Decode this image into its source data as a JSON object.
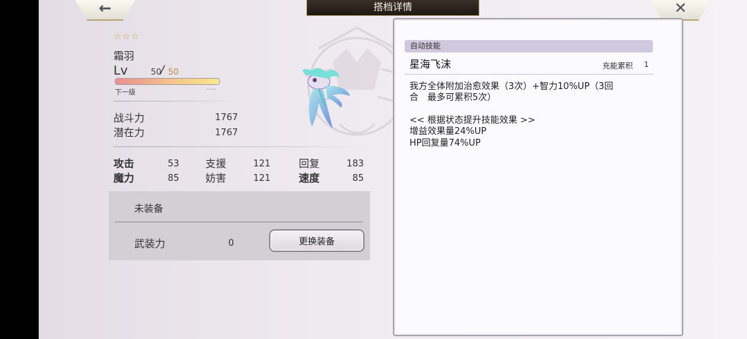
{
  "header": {
    "title": "搭档详情",
    "back_icon": "←",
    "close_icon": "✕"
  },
  "character": {
    "stars": "☆☆☆",
    "name": "霜羽",
    "level_label": "Lv",
    "level_current": "50",
    "level_slash": "/",
    "level_max": "50",
    "exp_fraction": 1.0,
    "next_level_label": "下一级",
    "next_level_value": "----",
    "combat_power_label": "战斗力",
    "combat_power": "1767",
    "potential_label": "潜在力",
    "potential": "1767"
  },
  "stats": {
    "attack_label": "攻击",
    "attack": "53",
    "magic_label": "魔力",
    "magic": "85",
    "support_label": "支援",
    "support": "121",
    "hinder_label": "妨害",
    "hinder": "121",
    "recover_label": "回复",
    "recover": "183",
    "speed_label": "速度",
    "speed": "85"
  },
  "equipment": {
    "status": "未装备",
    "power_label": "武装力",
    "power": "0",
    "change_button": "更换装备"
  },
  "skill": {
    "type_label": "自动技能",
    "name": "星海飞沫",
    "charge_label": "充能累积",
    "charge_value": "1",
    "desc_line1": "我方全体附加治愈效果（3次）+智力10%UP（3回",
    "desc_line2": "合　最多可累积5次）",
    "boost_header": "<< 根据状态提升技能效果 >>",
    "boost_1": "增益效果量24%UP",
    "boost_2": "HP回复量74%UP"
  },
  "colors": {
    "accent_gold": "#b8a574",
    "skill_tag_bg": "#cfc8de",
    "level_max": "#c8864a"
  }
}
